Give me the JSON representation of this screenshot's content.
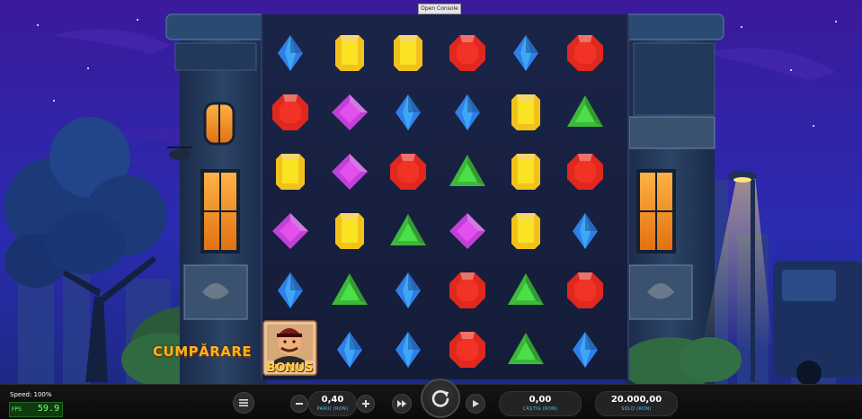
{
  "console": {
    "label": "Open Console"
  },
  "reels": [
    [
      "blue",
      "red",
      "yellow",
      "purple",
      "blue",
      "bonus"
    ],
    [
      "yellow",
      "purple",
      "purple",
      "yellow",
      "green",
      "blue"
    ],
    [
      "yellow",
      "blue",
      "red",
      "green",
      "blue",
      "blue"
    ],
    [
      "red",
      "blue",
      "green",
      "purple",
      "red",
      "red"
    ],
    [
      "blue",
      "yellow",
      "yellow",
      "yellow",
      "green",
      "green"
    ],
    [
      "red",
      "green",
      "red",
      "blue",
      "red",
      "blue"
    ]
  ],
  "buy_feature": {
    "label": "CUMPĂRARE"
  },
  "bonus_symbol": {
    "label": "BONUS"
  },
  "debug": {
    "speed": "Speed: 100%",
    "fps_label": "FPS",
    "fps_value": "59.9"
  },
  "controls": {
    "bet": {
      "value": "0,40",
      "label": "PARIU (RON)"
    },
    "win": {
      "value": "0,00",
      "label": "CÂȘTIG (RON)"
    },
    "balance": {
      "value": "20.000,00",
      "label": "SOLD (RON)"
    }
  },
  "colors": {
    "blue": "#2f7fe8",
    "red": "#e0281e",
    "yellow": "#f2c21c",
    "purple": "#c040d8",
    "green": "#3cb83a",
    "accent": "#4fc3f7"
  },
  "icons": {
    "menu": "menu-icon",
    "minus": "minus-icon",
    "plus": "plus-icon",
    "turbo": "fast-forward-icon",
    "spin": "spin-icon",
    "autoplay": "play-icon"
  }
}
